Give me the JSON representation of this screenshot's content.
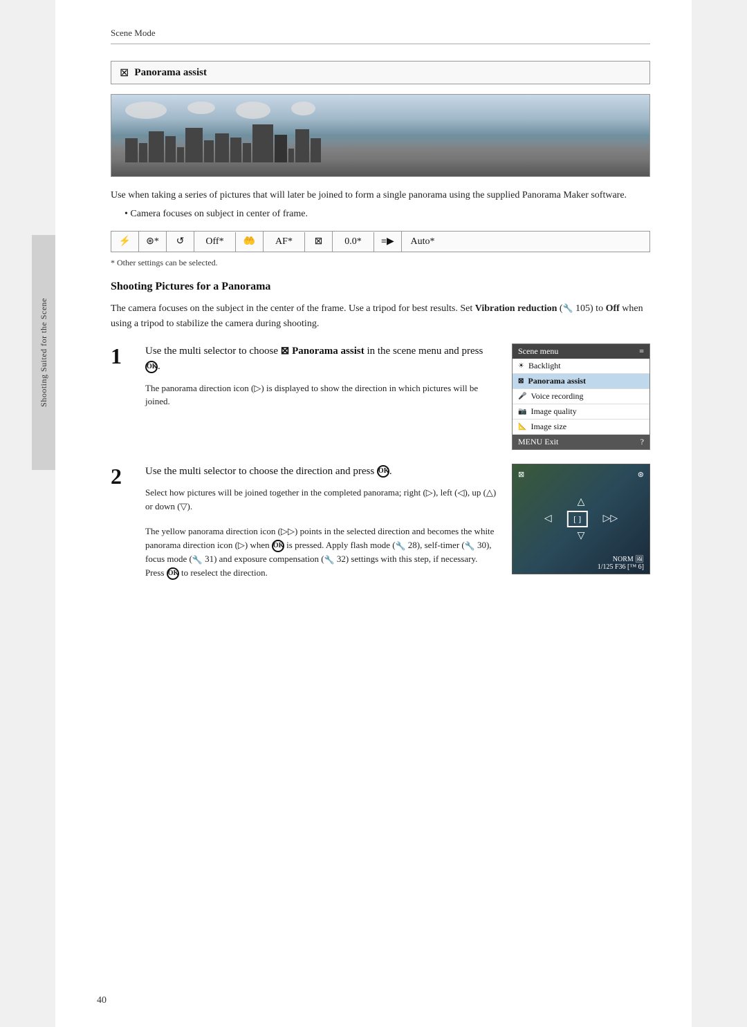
{
  "header": {
    "title": "Scene Mode"
  },
  "side_tab": {
    "text": "Shooting Suited for the Scene"
  },
  "section": {
    "icon": "⊠",
    "heading": "Panorama assist"
  },
  "panorama_description": "Use when taking a series of pictures that will later be joined to form a single panorama using the supplied Panorama Maker software.",
  "panorama_bullet": "Camera focuses on subject in center of frame.",
  "settings_bar": {
    "cells": [
      "⚡",
      "⊛*",
      "↺",
      "Off*",
      "🤲",
      "AF*",
      "⊠",
      "0.0*",
      "≡▶",
      "Auto*"
    ]
  },
  "asterisk_note": "* Other settings can be selected.",
  "shooting_heading": "Shooting Pictures for a Panorama",
  "shooting_intro": "The camera focuses on the subject in the center of the frame. Use a tripod for best results. Set Vibration reduction (🔧 105) to Off when using a tripod to stabilize the camera during shooting.",
  "step1": {
    "number": "1",
    "main_text": "Use the multi selector to choose ⊠ Panorama assist in the scene menu and press ⊛.",
    "sub_text": "The panorama direction icon (▷) is displayed to show the direction in which pictures will be joined."
  },
  "scene_menu": {
    "header": "Scene menu",
    "items": [
      {
        "icon": "☀",
        "label": "Backlight",
        "selected": false
      },
      {
        "icon": "⊠",
        "label": "Panorama assist",
        "selected": true
      },
      {
        "icon": "🎤",
        "label": "Voice recording",
        "selected": false
      },
      {
        "icon": "📷",
        "label": "Image quality",
        "selected": false
      },
      {
        "icon": "📐",
        "label": "Image size",
        "selected": false
      }
    ],
    "footer_left": "MENU Exit",
    "footer_right": "?"
  },
  "step2": {
    "number": "2",
    "main_text": "Use the multi selector to choose the direction and press ⊛.",
    "sub_text1": "Select how pictures will be joined together in the completed panorama; right (▷), left (◁), up (△) or down (▽).",
    "sub_text2": "The yellow panorama direction icon (▷▷) points in the selected direction and becomes the white panorama direction icon (▷) when ⊛ is pressed. Apply flash mode (🔧 28), self-timer (🔧 30), focus mode (🔧 31) and exposure compensation (🔧 32) settings with this step, if necessary. Press ⊛ to reselect the direction."
  },
  "camera_display": {
    "top_left": "⊠",
    "top_right": "⊛",
    "bracket": "[ ]",
    "arrows_right": "▷▷",
    "bottom": "NORM 🖼\n1/125  F36 [™  6]"
  },
  "page_number": "40"
}
